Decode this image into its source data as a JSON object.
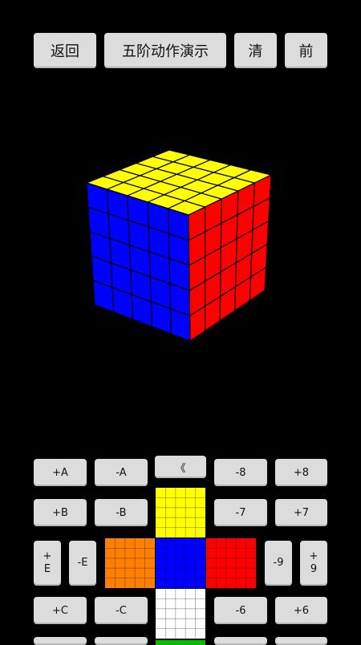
{
  "header": {
    "back_label": "返回",
    "title_label": "五阶动作演示",
    "clear_label": "清",
    "prev_label": "前"
  },
  "cube": {
    "order": 5,
    "colors": {
      "top": "#ffff00",
      "front": "#0000ff",
      "right": "#ff0000",
      "left": "#ff7f00",
      "bottom": "#ffffff",
      "back": "#00c000"
    }
  },
  "keypad": {
    "row1": [
      "+A",
      "-A",
      "《",
      "-8",
      "+8"
    ],
    "row2": [
      "+B",
      "-B",
      "-7",
      "+7"
    ],
    "row3_left": [
      "+",
      "E",
      "-E"
    ],
    "row3_right": [
      "-9",
      "+",
      "9"
    ],
    "row4": [
      "+C",
      "-C",
      "-6",
      "+6"
    ]
  }
}
